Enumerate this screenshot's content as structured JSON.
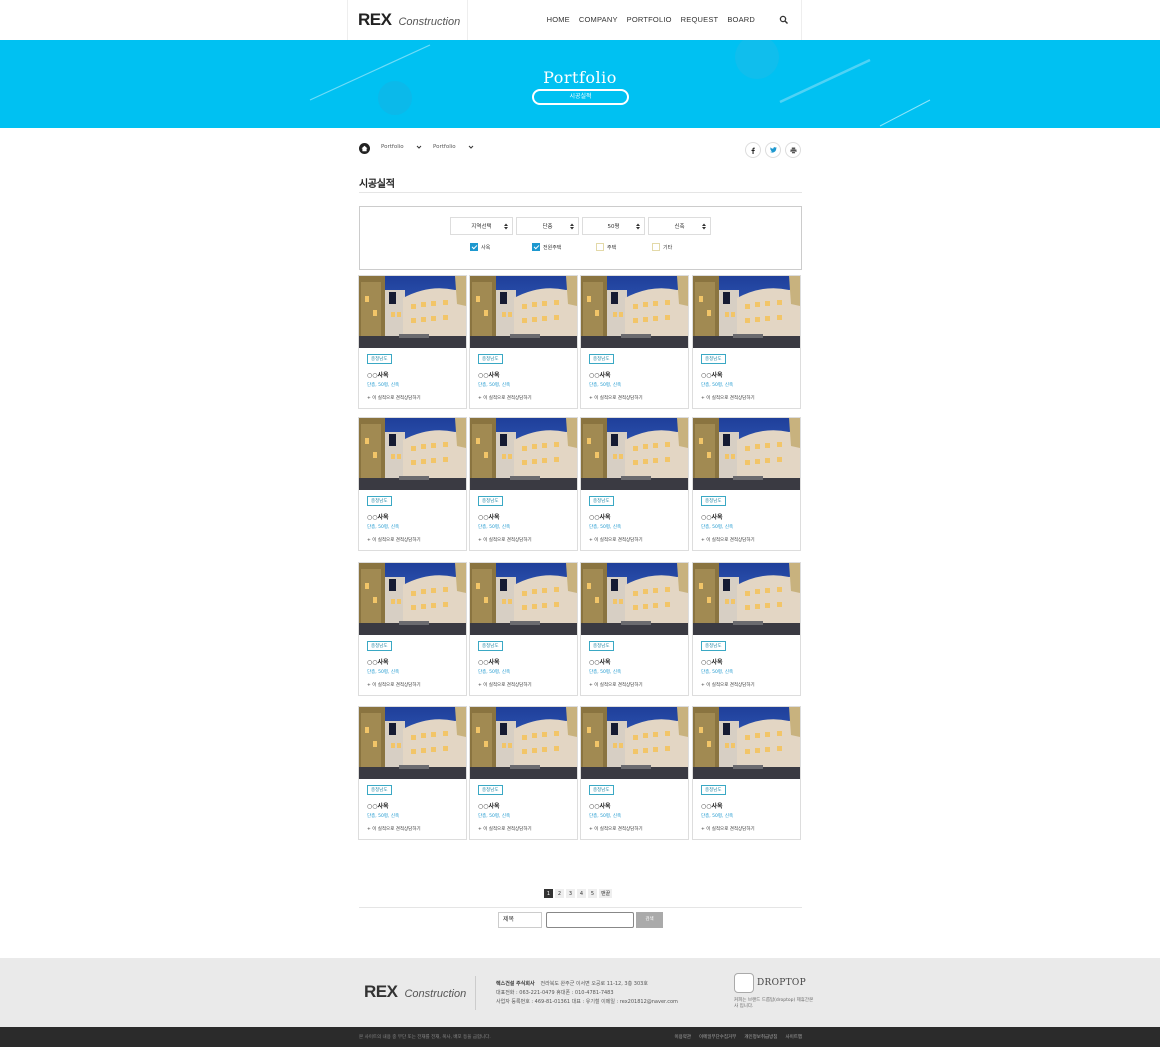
{
  "header": {
    "logo_main": "REX",
    "logo_sub": "Construction",
    "nav": [
      "HOME",
      "COMPANY",
      "PORTFOLIO",
      "REQUEST",
      "BOARD"
    ]
  },
  "banner": {
    "title": "Portfolio",
    "pill": "시공실적"
  },
  "breadcrumb": {
    "level1": "Portfolio",
    "level2": "Portfolio"
  },
  "page_title": "시공실적",
  "filter": {
    "selects": [
      "지역선택",
      "단층",
      "50평",
      "신축"
    ],
    "checks": [
      {
        "label": "사옥",
        "checked": true
      },
      {
        "label": "전원주택",
        "checked": true
      },
      {
        "label": "주택",
        "checked": false
      },
      {
        "label": "기타",
        "checked": false
      }
    ]
  },
  "card": {
    "tag": "충청남도",
    "name": "○○사옥",
    "meta": "단층, 50평, 신축",
    "link": "+ 이 실적으로 견적상담하기"
  },
  "pagination": {
    "pages": [
      "1",
      "2",
      "3",
      "4",
      "5"
    ],
    "next": "맨끝",
    "active": "1"
  },
  "search": {
    "field": "제목",
    "button": "검색"
  },
  "footer": {
    "company": "렉스건설 주식회사",
    "address": "전라북도 완주군 이서면 오공로 11-12, 3층 303호",
    "line2": "대표전화 : 063-221-0479    휴대폰 : 010-4781-7483",
    "line3": "사업자 등록번호 : 469-81-01361    대표 : 유기철    이메일 : rex201812@naver.com",
    "dt_logo": "DROPTOP",
    "dt_note": "커피는 브랜드 드롭탑(droptop) 제휴간본사 입니다.",
    "copyright": "본 사이트의 내용 중 무단 또는 전재를 전재, 복사, 배포 등을 금합니다.",
    "links": [
      "이용약관",
      "이메일무단수집거부",
      "개인정보취급방침",
      "사이트맵"
    ]
  },
  "colors": {
    "banner": "#00c1f2",
    "accent": "#1d98cf",
    "footer": "#eaeaea",
    "bottom_bar": "#2b2b2b"
  }
}
